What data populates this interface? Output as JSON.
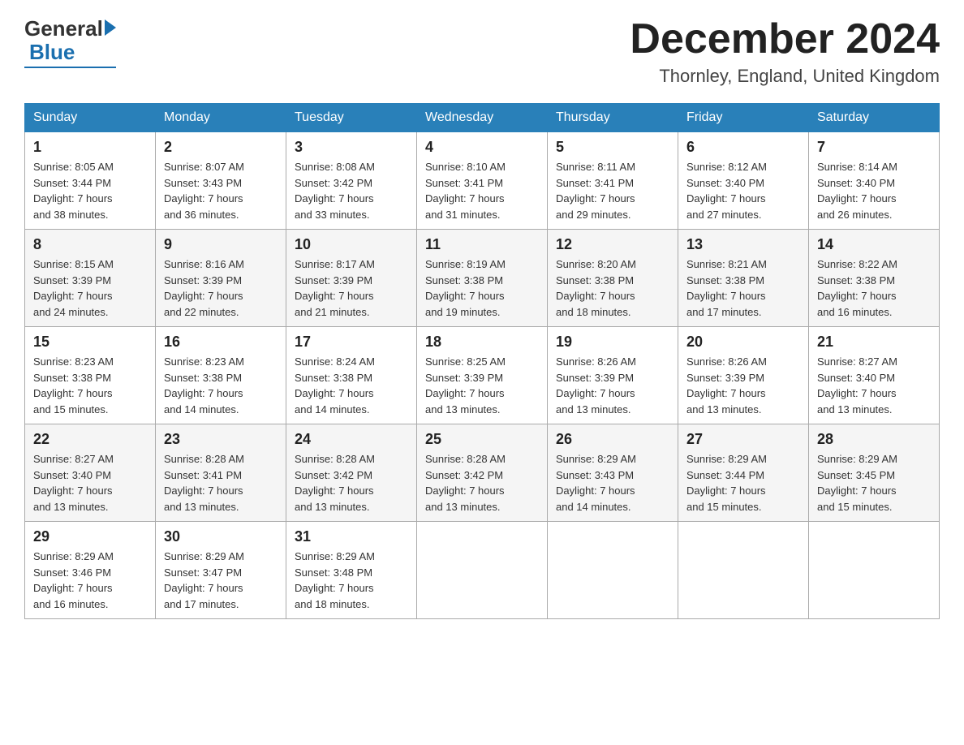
{
  "header": {
    "logo_general": "General",
    "logo_blue": "Blue",
    "month_title": "December 2024",
    "location": "Thornley, England, United Kingdom"
  },
  "columns": [
    "Sunday",
    "Monday",
    "Tuesday",
    "Wednesday",
    "Thursday",
    "Friday",
    "Saturday"
  ],
  "weeks": [
    [
      {
        "day": "1",
        "sunrise": "8:05 AM",
        "sunset": "3:44 PM",
        "daylight": "7 hours and 38 minutes."
      },
      {
        "day": "2",
        "sunrise": "8:07 AM",
        "sunset": "3:43 PM",
        "daylight": "7 hours and 36 minutes."
      },
      {
        "day": "3",
        "sunrise": "8:08 AM",
        "sunset": "3:42 PM",
        "daylight": "7 hours and 33 minutes."
      },
      {
        "day": "4",
        "sunrise": "8:10 AM",
        "sunset": "3:41 PM",
        "daylight": "7 hours and 31 minutes."
      },
      {
        "day": "5",
        "sunrise": "8:11 AM",
        "sunset": "3:41 PM",
        "daylight": "7 hours and 29 minutes."
      },
      {
        "day": "6",
        "sunrise": "8:12 AM",
        "sunset": "3:40 PM",
        "daylight": "7 hours and 27 minutes."
      },
      {
        "day": "7",
        "sunrise": "8:14 AM",
        "sunset": "3:40 PM",
        "daylight": "7 hours and 26 minutes."
      }
    ],
    [
      {
        "day": "8",
        "sunrise": "8:15 AM",
        "sunset": "3:39 PM",
        "daylight": "7 hours and 24 minutes."
      },
      {
        "day": "9",
        "sunrise": "8:16 AM",
        "sunset": "3:39 PM",
        "daylight": "7 hours and 22 minutes."
      },
      {
        "day": "10",
        "sunrise": "8:17 AM",
        "sunset": "3:39 PM",
        "daylight": "7 hours and 21 minutes."
      },
      {
        "day": "11",
        "sunrise": "8:19 AM",
        "sunset": "3:38 PM",
        "daylight": "7 hours and 19 minutes."
      },
      {
        "day": "12",
        "sunrise": "8:20 AM",
        "sunset": "3:38 PM",
        "daylight": "7 hours and 18 minutes."
      },
      {
        "day": "13",
        "sunrise": "8:21 AM",
        "sunset": "3:38 PM",
        "daylight": "7 hours and 17 minutes."
      },
      {
        "day": "14",
        "sunrise": "8:22 AM",
        "sunset": "3:38 PM",
        "daylight": "7 hours and 16 minutes."
      }
    ],
    [
      {
        "day": "15",
        "sunrise": "8:23 AM",
        "sunset": "3:38 PM",
        "daylight": "7 hours and 15 minutes."
      },
      {
        "day": "16",
        "sunrise": "8:23 AM",
        "sunset": "3:38 PM",
        "daylight": "7 hours and 14 minutes."
      },
      {
        "day": "17",
        "sunrise": "8:24 AM",
        "sunset": "3:38 PM",
        "daylight": "7 hours and 14 minutes."
      },
      {
        "day": "18",
        "sunrise": "8:25 AM",
        "sunset": "3:39 PM",
        "daylight": "7 hours and 13 minutes."
      },
      {
        "day": "19",
        "sunrise": "8:26 AM",
        "sunset": "3:39 PM",
        "daylight": "7 hours and 13 minutes."
      },
      {
        "day": "20",
        "sunrise": "8:26 AM",
        "sunset": "3:39 PM",
        "daylight": "7 hours and 13 minutes."
      },
      {
        "day": "21",
        "sunrise": "8:27 AM",
        "sunset": "3:40 PM",
        "daylight": "7 hours and 13 minutes."
      }
    ],
    [
      {
        "day": "22",
        "sunrise": "8:27 AM",
        "sunset": "3:40 PM",
        "daylight": "7 hours and 13 minutes."
      },
      {
        "day": "23",
        "sunrise": "8:28 AM",
        "sunset": "3:41 PM",
        "daylight": "7 hours and 13 minutes."
      },
      {
        "day": "24",
        "sunrise": "8:28 AM",
        "sunset": "3:42 PM",
        "daylight": "7 hours and 13 minutes."
      },
      {
        "day": "25",
        "sunrise": "8:28 AM",
        "sunset": "3:42 PM",
        "daylight": "7 hours and 13 minutes."
      },
      {
        "day": "26",
        "sunrise": "8:29 AM",
        "sunset": "3:43 PM",
        "daylight": "7 hours and 14 minutes."
      },
      {
        "day": "27",
        "sunrise": "8:29 AM",
        "sunset": "3:44 PM",
        "daylight": "7 hours and 15 minutes."
      },
      {
        "day": "28",
        "sunrise": "8:29 AM",
        "sunset": "3:45 PM",
        "daylight": "7 hours and 15 minutes."
      }
    ],
    [
      {
        "day": "29",
        "sunrise": "8:29 AM",
        "sunset": "3:46 PM",
        "daylight": "7 hours and 16 minutes."
      },
      {
        "day": "30",
        "sunrise": "8:29 AM",
        "sunset": "3:47 PM",
        "daylight": "7 hours and 17 minutes."
      },
      {
        "day": "31",
        "sunrise": "8:29 AM",
        "sunset": "3:48 PM",
        "daylight": "7 hours and 18 minutes."
      },
      null,
      null,
      null,
      null
    ]
  ],
  "labels": {
    "sunrise": "Sunrise:",
    "sunset": "Sunset:",
    "daylight": "Daylight:"
  }
}
